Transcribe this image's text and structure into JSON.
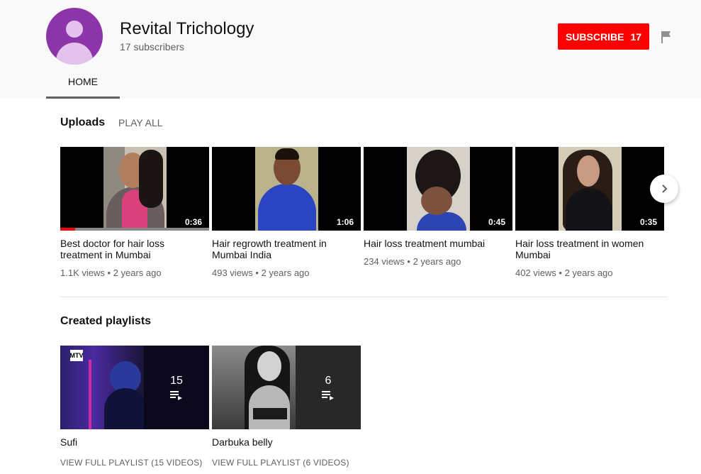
{
  "channel": {
    "name": "Revital Trichology",
    "subscribers": "17 subscribers",
    "subscribe_label": "SUBSCRIBE",
    "subscribe_count": "17",
    "avatar_color": "#8b35a8"
  },
  "tabs": [
    {
      "label": "HOME"
    }
  ],
  "uploads": {
    "title": "Uploads",
    "play_all": "PLAY ALL",
    "videos": [
      {
        "title": "Best doctor for hair loss treatment in Mumbai",
        "meta": "1.1K views • 2 years ago",
        "duration": "0:36",
        "watched_progress": 0.1
      },
      {
        "title": "Hair regrowth treatment in Mumbai India",
        "meta": "493 views • 2 years ago",
        "duration": "1:06"
      },
      {
        "title": "Hair loss treatment mumbai",
        "meta": "234 views • 2 years ago",
        "duration": "0:45"
      },
      {
        "title": "Hair loss treatment in women Mumbai",
        "meta": "402 views • 2 years ago",
        "duration": "0:35"
      }
    ]
  },
  "playlists": {
    "title": "Created playlists",
    "items": [
      {
        "title": "Sufi",
        "count": "15",
        "link": "VIEW FULL PLAYLIST (15 VIDEOS)",
        "badge": "MTV"
      },
      {
        "title": "Darbuka belly",
        "count": "6",
        "link": "VIEW FULL PLAYLIST (6 VIDEOS)"
      }
    ]
  },
  "icons": {
    "flag": "flag-icon",
    "next": "chevron-right-icon",
    "playlist": "playlist-icon"
  },
  "colors": {
    "brand_red": "#ff0000",
    "header_bg": "#f9f9f9",
    "meta_text": "#606060"
  }
}
